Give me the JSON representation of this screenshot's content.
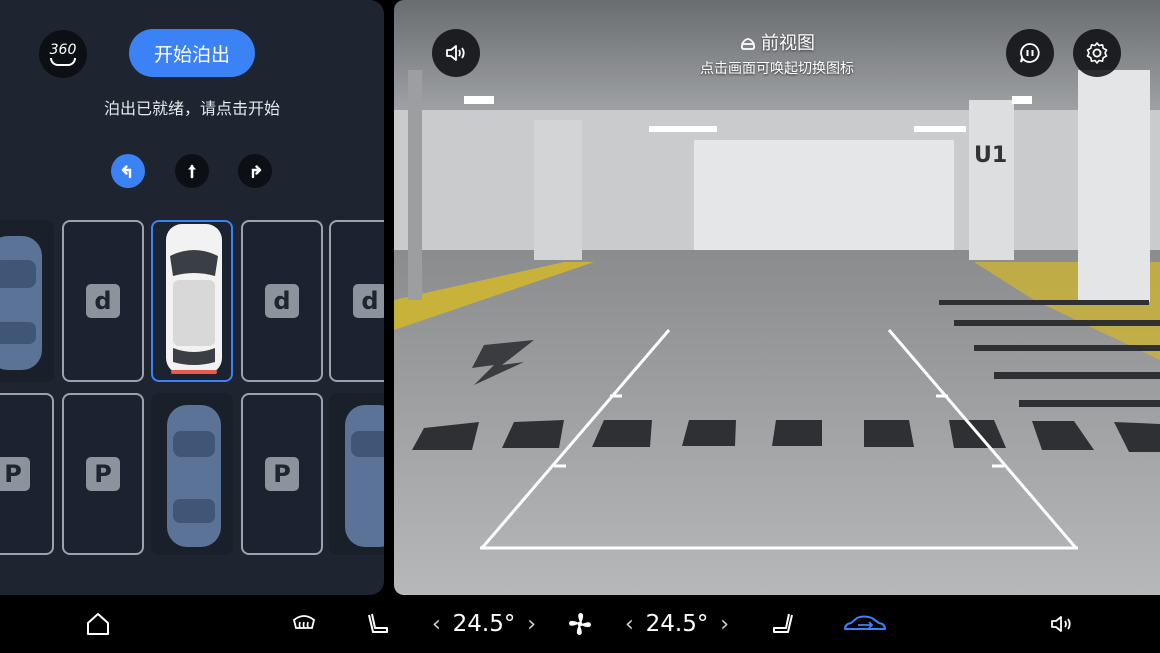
{
  "left_panel": {
    "btn_360_label": "360",
    "start_button_label": "开始泊出",
    "status_text": "泊出已就绪，请点击开始",
    "direction_buttons": [
      {
        "name": "turn-left",
        "active": true
      },
      {
        "name": "straight",
        "active": false
      },
      {
        "name": "turn-right",
        "active": false
      }
    ],
    "spots_top": [
      {
        "type": "car"
      },
      {
        "type": "empty",
        "label": "d"
      },
      {
        "type": "own-car",
        "selected": true
      },
      {
        "type": "empty",
        "label": "d"
      },
      {
        "type": "empty",
        "label": "d"
      }
    ],
    "spots_bottom": [
      {
        "type": "empty",
        "label": "P"
      },
      {
        "type": "empty",
        "label": "P"
      },
      {
        "type": "car"
      },
      {
        "type": "empty",
        "label": "P"
      },
      {
        "type": "car"
      }
    ]
  },
  "camera": {
    "title": "前视图",
    "subtitle": "点击画面可唤起切换图标",
    "sign_text": "U1",
    "icons": [
      "volume-icon",
      "voice-assistant-icon",
      "settings-icon"
    ]
  },
  "bottom_bar": {
    "left_temp": "24.5°",
    "right_temp": "24.5°",
    "chevron_left": "‹",
    "chevron_right": "›",
    "accent_color": "#3b82f6"
  }
}
